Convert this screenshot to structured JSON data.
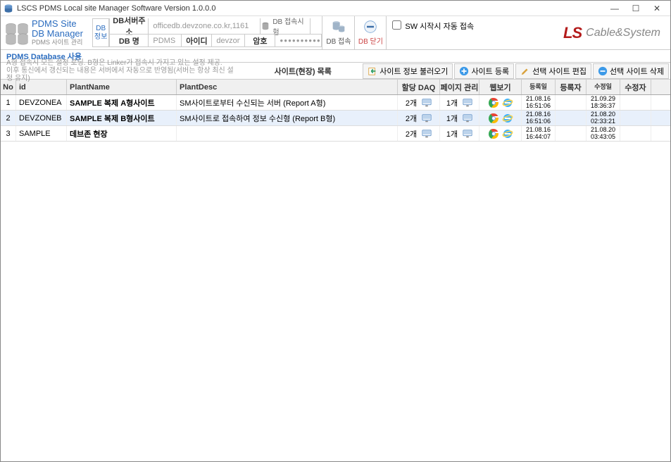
{
  "window": {
    "title": "LSCS PDMS Local site Manager Software Version 1.0.0.0"
  },
  "brand": {
    "line1": "PDMS Site",
    "line2": "DB Manager",
    "line3": "PDMS 사이트 관리"
  },
  "dbInfoLabel": "DB\n정보",
  "dbFields": {
    "serverAddrLabel": "DB서버주소",
    "serverAddrValue": "officedb.devzone.co.kr,1161",
    "dbNameLabel": "DB 명",
    "dbNameValue": "PDMS",
    "idLabel": "아이디",
    "idValue": "devzone",
    "pwLabel": "암호",
    "pwValue": "●●●●●●●●●●"
  },
  "toolbarBtns": {
    "dbTest": "DB 접속시험",
    "dbConnect": "DB 접속",
    "dbClose": "DB 닫기"
  },
  "autoConnect": "SW 시작시 자동 접속",
  "logo": {
    "ls": "LS",
    "rest": "Cable&System"
  },
  "sectionTitle": "PDMS Database 사용",
  "hintLine1": "A형 접속시 모든 설정 로딩. B형은 Linker가 접속시 가지고 있는 설정 제공.",
  "hintLine2": "이후 통신에서 갱신되는 내용은 서버에서 자동으로 반영됨(서버는 항상 최신 설정 유지)",
  "centerTitle": "사이트(현장) 목록",
  "actions": {
    "import": "사이트 정보 불러오기",
    "add": "사이트 등록",
    "edit": "선택 사이트 편집",
    "delete": "선택 사이트 삭제"
  },
  "columns": {
    "no": "No",
    "id": "id",
    "plantName": "PlantName",
    "plantDesc": "PlantDesc",
    "daq": "할당 DAQ",
    "page": "페이지 관리",
    "web": "웹보기",
    "regDate": "등록일",
    "regBy": "등록자",
    "modDate": "수정일",
    "modBy": "수정자"
  },
  "rows": [
    {
      "no": "1",
      "id": "DEVZONEA",
      "name": "SAMPLE 복제 A형사이트",
      "desc": "SM사이트로부터 수신되는 서버 (Report A형)",
      "daq": "2개",
      "page": "1개",
      "regDate": "21.08.16\n16:51:06",
      "modDate": "21.09.29\n18:36:37"
    },
    {
      "no": "2",
      "id": "DEVZONEB",
      "name": "SAMPLE 복제 B형사이트",
      "desc": "SM사이트로 접속하여 정보 수신형 (Report B형)",
      "daq": "2개",
      "page": "1개",
      "regDate": "21.08.16\n16:51:06",
      "modDate": "21.08.20\n02:33:21"
    },
    {
      "no": "3",
      "id": "SAMPLE",
      "name": "데브존 현장",
      "desc": "",
      "daq": "2개",
      "page": "1개",
      "regDate": "21.08.16\n16:44:07",
      "modDate": "21.08.20\n03:43:05"
    }
  ]
}
